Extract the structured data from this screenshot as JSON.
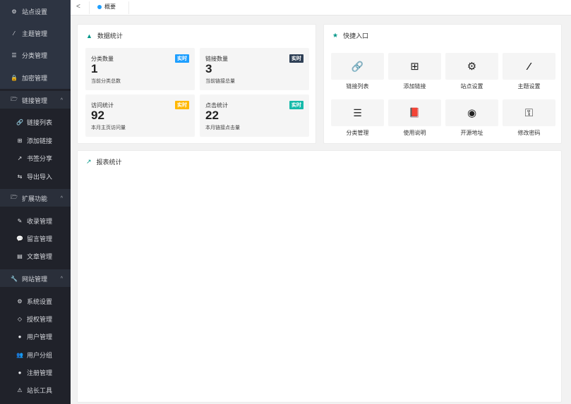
{
  "sidebar": {
    "items": [
      {
        "icon": "gear-icon",
        "glyph": "⚙",
        "label": "站点设置"
      },
      {
        "icon": "wand-icon",
        "glyph": "⁄",
        "label": "主题管理"
      },
      {
        "icon": "list-icon",
        "glyph": "☰",
        "label": "分类管理"
      },
      {
        "icon": "lock-icon",
        "glyph": "🔒",
        "label": "加密管理"
      }
    ],
    "groups": [
      {
        "icon": "folder-open-icon",
        "glyph": "🗁",
        "label": "链接管理",
        "arrow": "^",
        "items": [
          {
            "icon": "link-icon",
            "glyph": "🔗",
            "label": "链接列表"
          },
          {
            "icon": "plus-square-icon",
            "glyph": "⊞",
            "label": "添加链接"
          },
          {
            "icon": "external-link-icon",
            "glyph": "↗",
            "label": "书签分享"
          },
          {
            "icon": "retweet-icon",
            "glyph": "⇆",
            "label": "导出导入"
          }
        ]
      },
      {
        "icon": "folder-open-icon",
        "glyph": "🗁",
        "label": "扩展功能",
        "arrow": "^",
        "items": [
          {
            "icon": "pencil-icon",
            "glyph": "✎",
            "label": "收录管理"
          },
          {
            "icon": "comment-icon",
            "glyph": "💬",
            "label": "留言管理"
          },
          {
            "icon": "file-text-icon",
            "glyph": "▤",
            "label": "文章管理"
          }
        ]
      },
      {
        "icon": "wrench-icon",
        "glyph": "🔧",
        "label": "网站管理",
        "arrow": "^",
        "items": [
          {
            "icon": "cogs-icon",
            "glyph": "⚙",
            "label": "系统设置"
          },
          {
            "icon": "diamond-icon",
            "glyph": "◇",
            "label": "授权管理"
          },
          {
            "icon": "user-icon",
            "glyph": "●",
            "label": "用户管理"
          },
          {
            "icon": "users-icon",
            "glyph": "👥",
            "label": "用户分组"
          },
          {
            "icon": "user-plus-icon",
            "glyph": "●",
            "label": "注册管理"
          },
          {
            "icon": "warning-icon",
            "glyph": "⚠",
            "label": "站长工具"
          }
        ]
      }
    ]
  },
  "header": {
    "back_glyph": "<",
    "tab_label": "概要"
  },
  "stats_card": {
    "title": "数据统计",
    "icon_glyph": "▲",
    "stats": [
      {
        "label": "分类数量",
        "value": "1",
        "desc": "当前分类总数",
        "badge": "实时",
        "badge_color": "#1e9fff"
      },
      {
        "label": "链接数量",
        "value": "3",
        "desc": "当前链接总量",
        "badge": "实时",
        "badge_color": "#2f4056"
      },
      {
        "label": "访问统计",
        "value": "92",
        "desc": "本月主页访问量",
        "badge": "实时",
        "badge_color": "#ffb800"
      },
      {
        "label": "点击统计",
        "value": "22",
        "desc": "本月链接点击量",
        "badge": "实时",
        "badge_color": "#16baaa"
      }
    ]
  },
  "quick_card": {
    "title": "快捷入口",
    "icon_glyph": "★",
    "items": [
      {
        "icon": "link-icon",
        "glyph": "🔗",
        "label": "链接列表"
      },
      {
        "icon": "plus-square-icon",
        "glyph": "⊞",
        "label": "添加链接"
      },
      {
        "icon": "gear-icon",
        "glyph": "⚙",
        "label": "站点设置"
      },
      {
        "icon": "magic-wand-icon",
        "glyph": "⁄",
        "label": "主题设置"
      },
      {
        "icon": "list-icon",
        "glyph": "☰",
        "label": "分类管理"
      },
      {
        "icon": "book-icon",
        "glyph": "📕",
        "label": "使用说明"
      },
      {
        "icon": "github-icon",
        "glyph": "◉",
        "label": "开源地址"
      },
      {
        "icon": "key-icon",
        "glyph": "⚿",
        "label": "修改密码"
      }
    ]
  },
  "report_card": {
    "title": "报表统计",
    "icon_glyph": "↗"
  },
  "colors": {
    "accent_teal": "#009688",
    "sidebar_bg": "#20222a"
  }
}
